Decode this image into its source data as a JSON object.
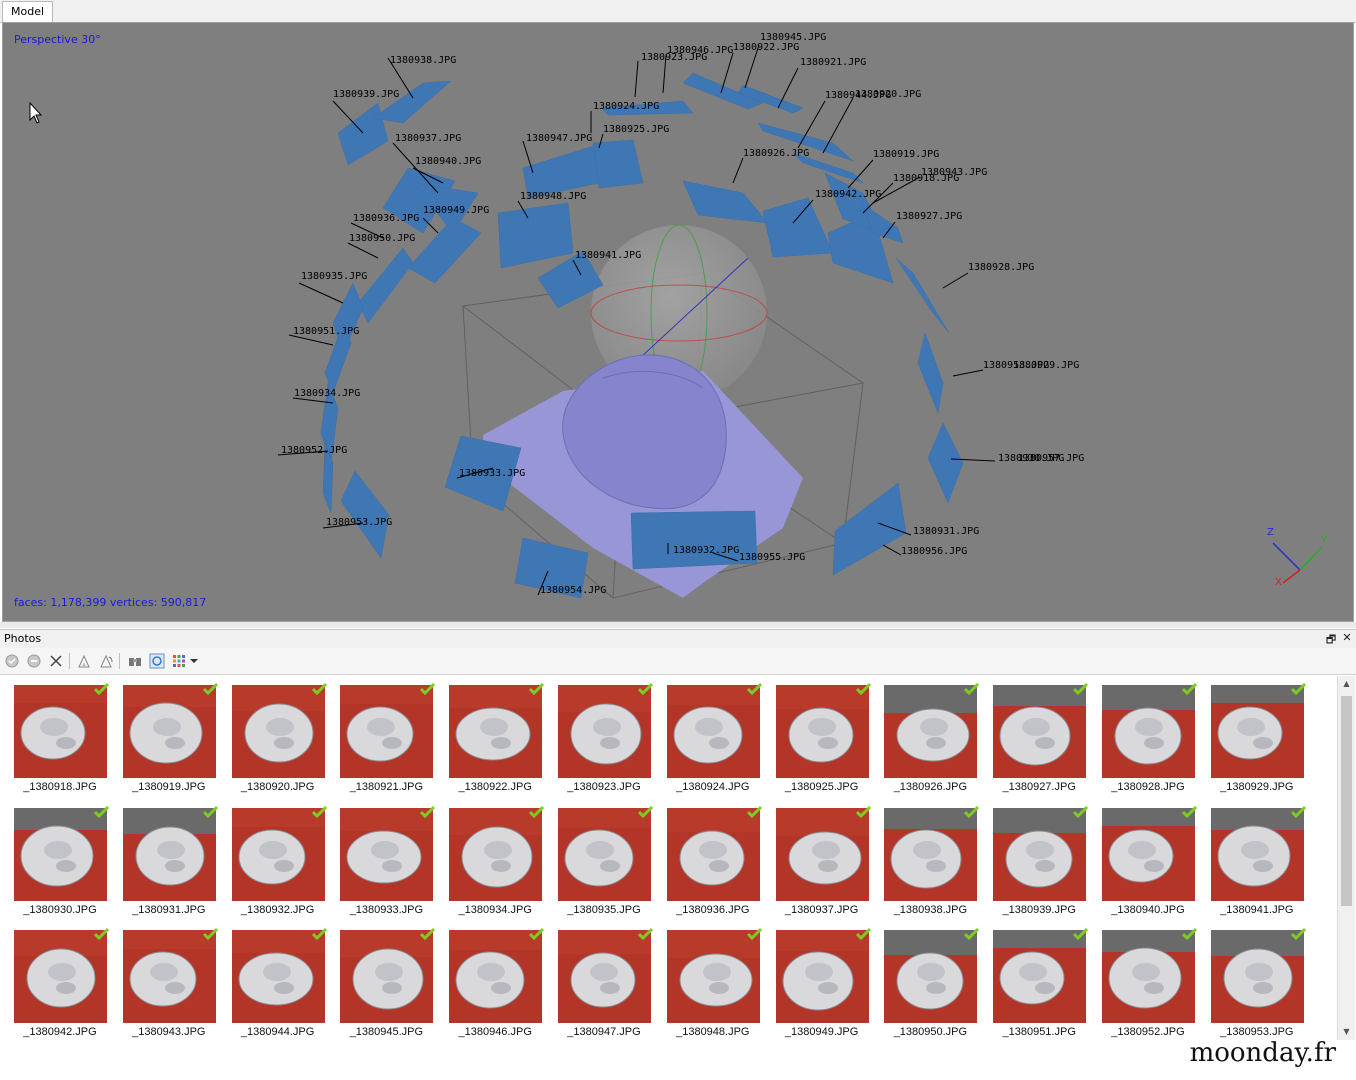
{
  "tabs": {
    "model": "Model"
  },
  "viewport": {
    "projection": "Perspective 30°",
    "stats": "faces: 1,178,399 vertices: 590,817",
    "axes": {
      "x": "X",
      "y": "Y",
      "z": "Z"
    },
    "camera_labels": [
      "1380938.JPG",
      "1380939.JPG",
      "1380937.JPG",
      "1380940.JPG",
      "1380949.JPG",
      "1380936.JPG",
      "1380950.JPG",
      "1380935.JPG",
      "1380951.JPG",
      "1380934.JPG",
      "1380952.JPG",
      "1380953.JPG",
      "1380933.JPG",
      "1380954.JPG",
      "1380932.JPG",
      "1380955.JPG",
      "1380931.JPG",
      "1380956.JPG",
      "1380947.JPG",
      "1380948.JPG",
      "1380941.JPG",
      "1380923.JPG",
      "1380946.JPG",
      "1380945.JPG",
      "1380922.JPG",
      "1380921.JPG",
      "1380924.JPG",
      "1380925.JPG",
      "1380926.JPG",
      "1380944.JPG",
      "1380920.JPG",
      "1380919.JPG",
      "1380943.JPG",
      "1380918.JPG",
      "1380942.JPG",
      "1380927.JPG",
      "1380928.JPG",
      "1380958.JPG",
      "1380929.JPG",
      "1380930.JPG",
      "1380957.JPG"
    ]
  },
  "panel": {
    "title": "Photos",
    "float_glyph": "🗗",
    "close_glyph": "✕"
  },
  "toolbar_icons": [
    "enable-icon",
    "disable-icon",
    "remove-icon",
    "rotate-left-icon",
    "rotate-right-icon",
    "binoculars-icon",
    "view-icon",
    "grid-icon",
    "dropdown-icon"
  ],
  "photos": [
    "_1380918.JPG",
    "_1380919.JPG",
    "_1380920.JPG",
    "_1380921.JPG",
    "_1380922.JPG",
    "_1380923.JPG",
    "_1380924.JPG",
    "_1380925.JPG",
    "_1380926.JPG",
    "_1380927.JPG",
    "_1380928.JPG",
    "_1380929.JPG",
    "_1380930.JPG",
    "_1380931.JPG",
    "_1380932.JPG",
    "_1380933.JPG",
    "_1380934.JPG",
    "_1380935.JPG",
    "_1380936.JPG",
    "_1380937.JPG",
    "_1380938.JPG",
    "_1380939.JPG",
    "_1380940.JPG",
    "_1380941.JPG",
    "_1380942.JPG",
    "_1380943.JPG",
    "_1380944.JPG",
    "_1380945.JPG",
    "_1380946.JPG",
    "_1380947.JPG",
    "_1380948.JPG",
    "_1380949.JPG",
    "_1380950.JPG",
    "_1380951.JPG",
    "_1380952.JPG",
    "_1380953.JPG"
  ],
  "scroll": {
    "up": "▲",
    "down": "▼"
  },
  "watermark": "moonday.fr",
  "colors": {
    "viewport_bg": "#7f7f7f",
    "camera_plane": "#3f77b5",
    "mesh": "#9a98d8",
    "check": "#7ccc22",
    "overlay_text": "#1a1ad8"
  }
}
